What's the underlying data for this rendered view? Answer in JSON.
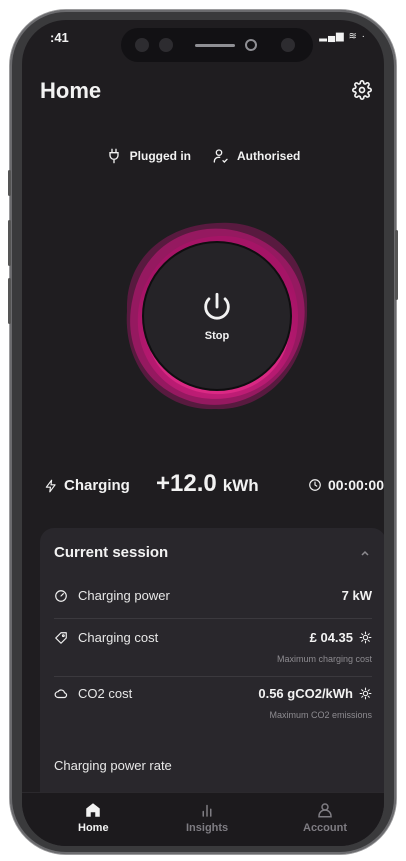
{
  "status_bar": {
    "time": ":41",
    "icons": "▂▄▆ ≋ ·"
  },
  "header": {
    "title": "Home",
    "settings_icon": "gear-icon"
  },
  "connection": {
    "plugged": {
      "label": "Plugged in",
      "icon": "plug-icon"
    },
    "authorised": {
      "label": "Authorised",
      "icon": "user-check-icon"
    }
  },
  "control": {
    "stop_label": "Stop",
    "icon": "power-icon",
    "accent": "#e8127c"
  },
  "stats": {
    "state_label": "Charging",
    "energy_value": "+12.0",
    "energy_unit": "kWh",
    "duration": "00:00:00"
  },
  "session": {
    "title": "Current session",
    "rows": [
      {
        "label": "Charging power",
        "value": "7 kW",
        "icon": "gauge-icon"
      },
      {
        "label": "Charging cost",
        "value": "£ 04.35",
        "icon": "tag-icon",
        "sub": "Maximum charging cost"
      },
      {
        "label": "CO2 cost",
        "value": "0.56 gCO2/kWh",
        "icon": "cloud-icon",
        "sub": "Maximum CO2 emissions"
      }
    ],
    "rate_label": "Charging power rate"
  },
  "tabs": [
    {
      "label": "Home",
      "icon": "home-icon",
      "active": true
    },
    {
      "label": "Insights",
      "icon": "bar-chart-icon",
      "active": false
    },
    {
      "label": "Account",
      "icon": "user-icon",
      "active": false
    }
  ]
}
